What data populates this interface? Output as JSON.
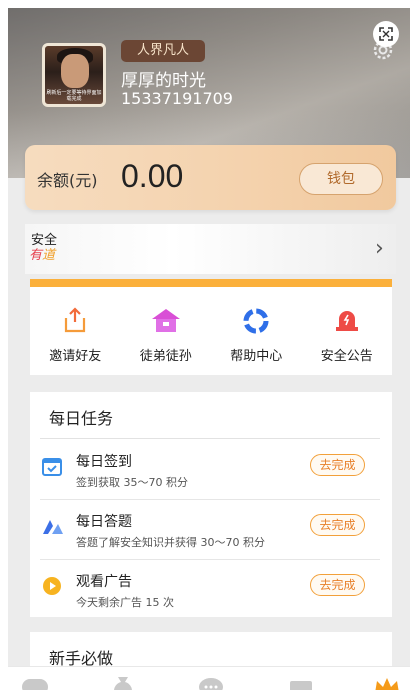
{
  "header": {
    "rank": "人界凡人",
    "nickname": "厚厚的时光",
    "phone": "15337191709",
    "avatar_caption": "刷新后一定要等待界面加载完成"
  },
  "balance": {
    "label": "余额(元)",
    "value": "0.00",
    "wallet_button": "钱包"
  },
  "security": {
    "title": "安全",
    "brand_part1": "有",
    "brand_part2": "道"
  },
  "grid": [
    {
      "label": "邀请好友",
      "icon": "share-icon"
    },
    {
      "label": "徒弟徒孙",
      "icon": "house-icon"
    },
    {
      "label": "帮助中心",
      "icon": "help-ring-icon"
    },
    {
      "label": "安全公告",
      "icon": "alarm-icon"
    }
  ],
  "daily_tasks": {
    "title": "每日任务",
    "items": [
      {
        "name": "每日签到",
        "desc": "签到获取 35～70 积分",
        "button": "去完成"
      },
      {
        "name": "每日答题",
        "desc": "答题了解安全知识并获得 30～70 积分",
        "button": "去完成"
      },
      {
        "name": "观看广告",
        "desc": "今天剩余广告 15 次",
        "button": "去完成"
      }
    ]
  },
  "newbie": {
    "title": "新手必做"
  },
  "colors": {
    "accent": "#fbb03b",
    "button_text": "#e8802a",
    "rank_badge": "#6b4634"
  }
}
